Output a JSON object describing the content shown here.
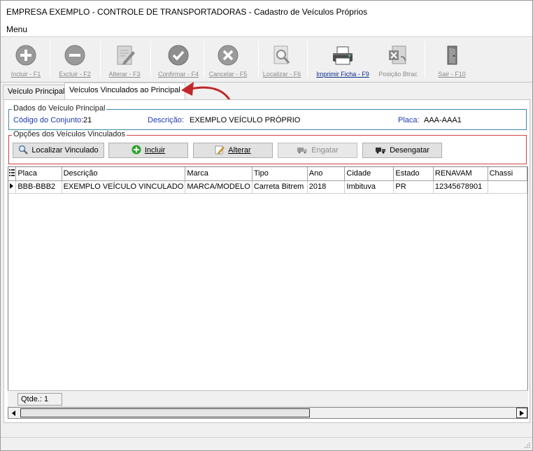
{
  "window": {
    "title": "EMPRESA EXEMPLO - CONTROLE DE TRANSPORTADORAS - Cadastro de Veículos Próprios"
  },
  "menu": {
    "label": "Menu"
  },
  "toolbar": {
    "incluir": "Incluir - F1",
    "excluir": "Excluir - F2",
    "alterar": "Alterar - F3",
    "confirmar": "Confirmar - F4",
    "cancelar": "Cancelar - F5",
    "localizar": "Localizar - F6",
    "imprimir": "Imprimir Ficha - F9",
    "posicao": "Posição Btrac",
    "sair": "Sair - F10"
  },
  "tabs": {
    "principal": "Veículo Principal",
    "vinculados": "Veículos Vinculados ao Principal"
  },
  "dados": {
    "title": "Dados do Veículo Principal",
    "codigo_label": "Código do Conjunto:",
    "codigo_value": "21",
    "descricao_label": "Descrição:",
    "descricao_value": "EXEMPLO VEÍCULO PRÓPRIO",
    "placa_label": "Placa:",
    "placa_value": "AAA-AAA1"
  },
  "opcoes": {
    "title": "Opções dos Veículos Vinculados",
    "localizar": "Localizar Vinculado",
    "incluir": "Incluir",
    "alterar": "Alterar",
    "engatar": "Engatar",
    "desengatar": "Desengatar"
  },
  "grid": {
    "columns": [
      "Placa",
      "Descrição",
      "Marca",
      "Tipo",
      "Ano",
      "Cidade",
      "Estado",
      "RENAVAM",
      "Chassi"
    ],
    "rows": [
      [
        "BBB-BBB2",
        "EXEMPLO VEÍCULO VINCULADO",
        "MARCA/MODELO",
        "Carreta Bitrem",
        "2018",
        "Imbituva",
        "PR",
        "12345678901",
        ""
      ]
    ]
  },
  "footer": {
    "qtde": "Qtde.: 1"
  },
  "colors": {
    "accent_red": "#c0282a",
    "blue_label": "#1e3ab0"
  }
}
